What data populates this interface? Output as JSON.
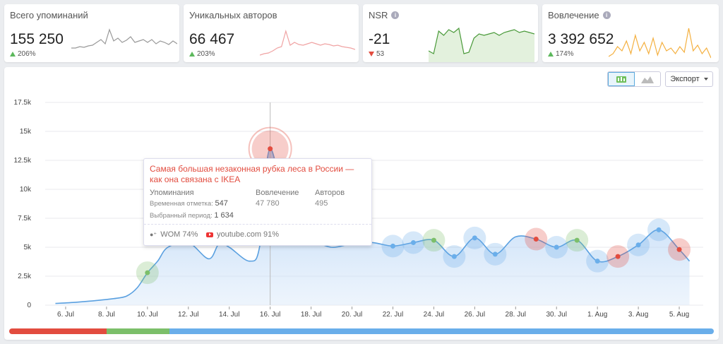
{
  "cards": [
    {
      "title": "Всего упоминаний",
      "value": "155 250",
      "delta": "206%",
      "direction": "up",
      "info": false,
      "color": "#999999"
    },
    {
      "title": "Уникальных авторов",
      "value": "66 467",
      "delta": "203%",
      "direction": "up",
      "info": false,
      "color": "#f0a3a3"
    },
    {
      "title": "NSR",
      "value": "-21",
      "delta": "53",
      "direction": "down",
      "info": true,
      "color": "#4a9a3a"
    },
    {
      "title": "Вовлечение",
      "value": "3 392 652",
      "delta": "174%",
      "direction": "up",
      "info": true,
      "color": "#f4b040"
    }
  ],
  "toolbar": {
    "export_label": "Экспорт"
  },
  "tooltip": {
    "title": "Самая большая незаконная рубка леса в России — как она связана с IKEA",
    "mentions_label": "Упоминания",
    "engagement_label": "Вовлечение",
    "authors_label": "Авторов",
    "engagement_value": "47 780",
    "authors_value": "495",
    "timestamp_label": "Временная отметка:",
    "timestamp_value": "547",
    "period_label": "Выбранный период:",
    "period_value": "1 634",
    "wom_label": "WOM 74%",
    "source_label": "youtube.com 91%"
  },
  "colors": {
    "positive": "#7cbf6a",
    "negative": "#e24c3f",
    "neutral": "#6aaeea",
    "line": "#5aa0e0"
  },
  "sentiment_bar": [
    {
      "name": "negative",
      "share": 0.138
    },
    {
      "name": "positive",
      "share": 0.089
    },
    {
      "name": "neutral",
      "share": 0.773
    }
  ],
  "chart_data": {
    "type": "area",
    "x_ticks": [
      "6. Jul",
      "8. Jul",
      "10. Jul",
      "12. Jul",
      "14. Jul",
      "16. Jul",
      "18. Jul",
      "20. Jul",
      "22. Jul",
      "24. Jul",
      "26. Jul",
      "28. Jul",
      "30. Jul",
      "1. Aug",
      "3. Aug",
      "5. Aug"
    ],
    "y_ticks": [
      "0",
      "2.5k",
      "5k",
      "7.5k",
      "10k",
      "12.5k",
      "15k",
      "17.5k"
    ],
    "ylim": [
      0,
      17500
    ],
    "x": [
      4.5,
      5.5,
      6.5,
      7.5,
      8.0,
      8.5,
      9.0,
      9.5,
      10.0,
      11.0,
      12.0,
      12.5,
      13.0,
      14.0,
      14.5,
      15.0,
      16.0,
      17.0,
      18.0,
      19.0,
      20.0,
      21.0,
      22.0,
      23.0,
      24.0,
      25.0,
      26.0,
      27.0,
      28.0,
      29.0,
      30.0,
      31.0,
      32.0,
      33.0,
      34.0,
      35.0,
      35.5
    ],
    "y": [
      150,
      250,
      400,
      600,
      800,
      1500,
      2800,
      3800,
      5000,
      5400,
      4000,
      5300,
      5000,
      3800,
      5200,
      13500,
      6000,
      5600,
      5000,
      5300,
      5400,
      5100,
      5400,
      5600,
      4200,
      5800,
      4400,
      5900,
      5700,
      5000,
      5600,
      3800,
      4200,
      5200,
      6500,
      4800,
      3800
    ],
    "markers": [
      {
        "x": 9.0,
        "y": 2800,
        "sentiment": "positive"
      },
      {
        "x": 15.0,
        "y": 13500,
        "sentiment": "negative"
      },
      {
        "x": 21.0,
        "y": 5100,
        "sentiment": "neutral"
      },
      {
        "x": 22.0,
        "y": 5400,
        "sentiment": "neutral"
      },
      {
        "x": 23.0,
        "y": 5600,
        "sentiment": "positive"
      },
      {
        "x": 24.0,
        "y": 4200,
        "sentiment": "neutral"
      },
      {
        "x": 25.0,
        "y": 5800,
        "sentiment": "neutral"
      },
      {
        "x": 26.0,
        "y": 4400,
        "sentiment": "neutral"
      },
      {
        "x": 28.0,
        "y": 5700,
        "sentiment": "negative"
      },
      {
        "x": 29.0,
        "y": 5000,
        "sentiment": "neutral"
      },
      {
        "x": 30.0,
        "y": 5600,
        "sentiment": "positive"
      },
      {
        "x": 31.0,
        "y": 3800,
        "sentiment": "neutral"
      },
      {
        "x": 32.0,
        "y": 4200,
        "sentiment": "negative"
      },
      {
        "x": 33.0,
        "y": 5200,
        "sentiment": "neutral"
      },
      {
        "x": 34.0,
        "y": 6500,
        "sentiment": "neutral"
      },
      {
        "x": 35.0,
        "y": 4800,
        "sentiment": "negative"
      }
    ],
    "grid": true
  }
}
